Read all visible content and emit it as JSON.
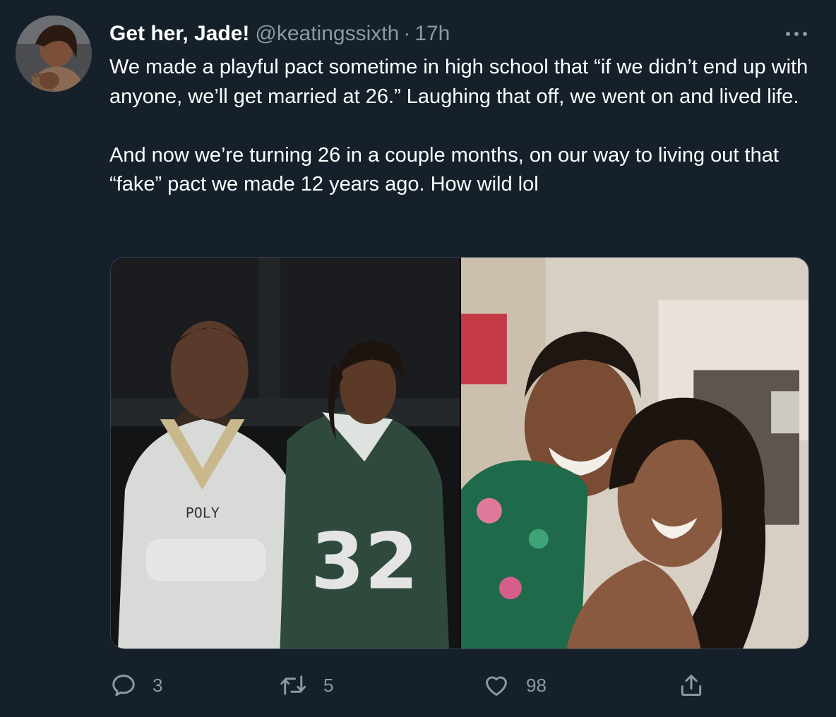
{
  "tweet": {
    "display_name": "Get her, Jade!",
    "handle": "@keatingssixth",
    "separator": "·",
    "timestamp": "17h",
    "paragraphs": [
      "We made a playful pact sometime in high school that “if we didn’t end up with anyone, we’ll get married at 26.” Laughing that off, we went on and lived life.",
      "And now we’re turning 26 in a couple months, on our way to living out that “fake” pact we made 12 years ago. How wild lol"
    ],
    "media": {
      "left_jersey_text": "POLY",
      "right_jersey_number": "32"
    },
    "actions": {
      "reply_icon": "reply-icon",
      "reply_count": "3",
      "retweet_icon": "retweet-icon",
      "retweet_count": "5",
      "like_icon": "heart-icon",
      "like_count": "98",
      "share_icon": "share-icon"
    }
  },
  "colors": {
    "background": "#15202b",
    "text_primary": "#ffffff",
    "text_secondary": "#8b98a5",
    "border": "#38444d"
  }
}
